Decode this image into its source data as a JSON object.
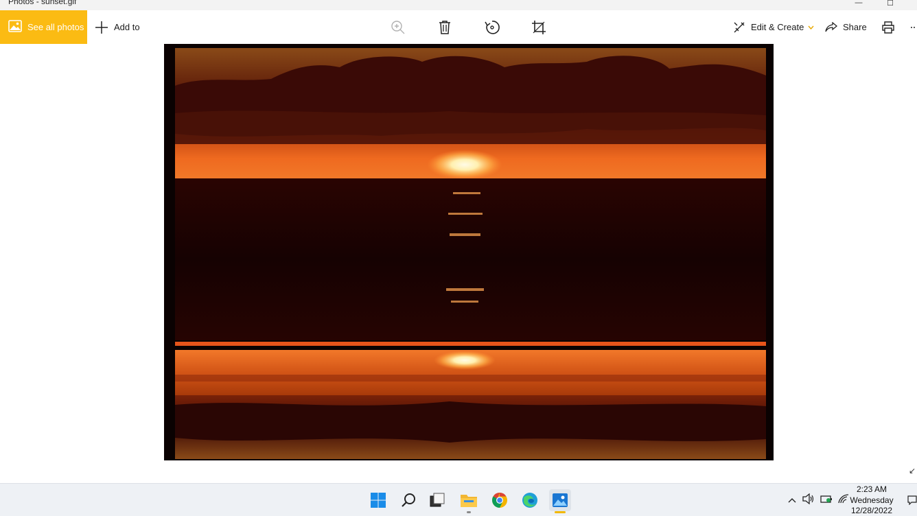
{
  "window": {
    "title": "Photos - sunset.gif",
    "controls": {
      "minimize": "—",
      "maximize": "☐"
    }
  },
  "toolbar": {
    "see_all_label": "See all photos",
    "add_to_label": "Add to",
    "edit_create_label": "Edit & Create",
    "share_label": "Share"
  },
  "photo": {
    "description": "sunset.gif",
    "colors": {
      "frame": "#0a0202",
      "sky_top": "#7a3a10",
      "sun": "#fff3c0",
      "horizon": "#e0561a",
      "water": "#1a0202"
    }
  },
  "taskbar": {
    "icons": [
      "windows-start-icon",
      "search-icon",
      "task-view-icon",
      "file-explorer-icon",
      "chrome-icon",
      "edge-icon",
      "photos-icon"
    ]
  },
  "clock": {
    "time": "2:23 AM",
    "day": "Wednesday",
    "date": "12/28/2022"
  },
  "colors": {
    "accent": "#fbbb13",
    "taskbar_bg": "#eef1f5"
  }
}
